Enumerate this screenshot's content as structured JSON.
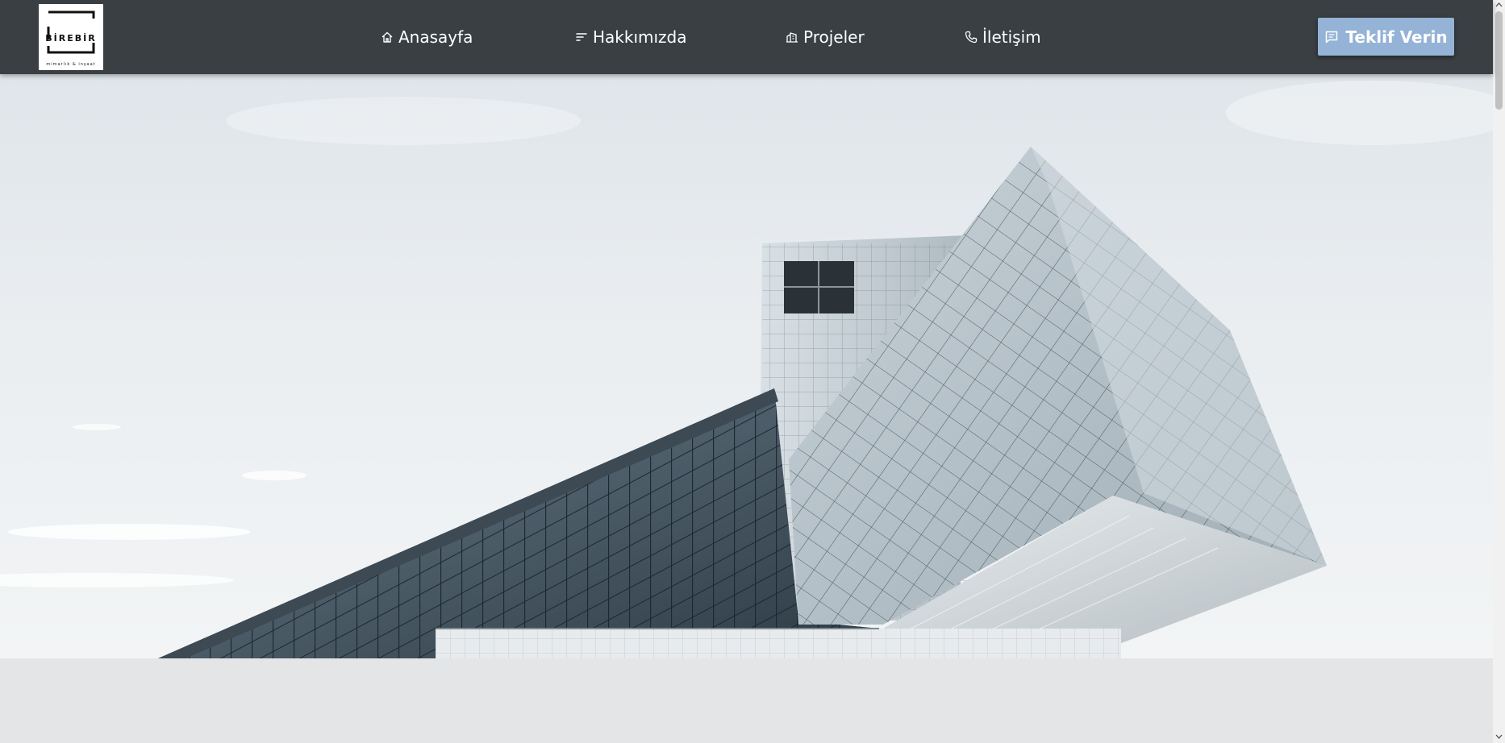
{
  "brand": {
    "logo_text": "BİREBİR",
    "logo_subtext": "mimarlık & inşaat"
  },
  "nav": {
    "items": [
      {
        "label": "Anasayfa",
        "icon": "home-icon"
      },
      {
        "label": "Hakkımızda",
        "icon": "sort-lines-icon"
      },
      {
        "label": "Projeler",
        "icon": "building-icon"
      },
      {
        "label": "İletişim",
        "icon": "phone-icon"
      }
    ]
  },
  "cta": {
    "label": "Teklif Verin",
    "icon": "message-icon"
  },
  "colors": {
    "navbar_bg": "#3a3f44",
    "cta_bg": "#94b3d6",
    "page_bg": "#e4e5e7"
  }
}
